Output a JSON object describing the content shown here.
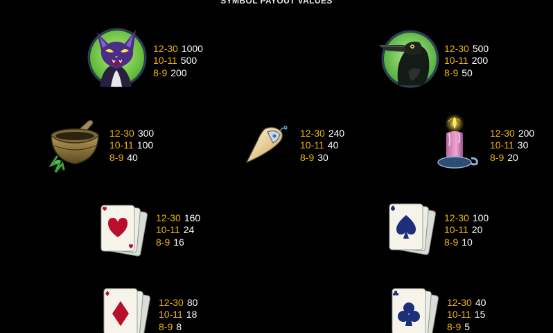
{
  "header": {
    "title": "SYMBOL PAYOUT VALUES"
  },
  "colors": {
    "background": "#000000",
    "range_text": "#f2b705",
    "value_text": "#ffffff"
  },
  "symbols": [
    {
      "icon": "black-cat-icon",
      "payouts": [
        {
          "range": "12-30",
          "value": "1000"
        },
        {
          "range": "10-11",
          "value": "500"
        },
        {
          "range": "8-9",
          "value": "200"
        }
      ]
    },
    {
      "icon": "raven-icon",
      "payouts": [
        {
          "range": "12-30",
          "value": "500"
        },
        {
          "range": "10-11",
          "value": "200"
        },
        {
          "range": "8-9",
          "value": "50"
        }
      ]
    },
    {
      "icon": "mortar-pestle-icon",
      "payouts": [
        {
          "range": "12-30",
          "value": "300"
        },
        {
          "range": "10-11",
          "value": "100"
        },
        {
          "range": "8-9",
          "value": "40"
        }
      ]
    },
    {
      "icon": "fang-amulet-icon",
      "payouts": [
        {
          "range": "12-30",
          "value": "240"
        },
        {
          "range": "10-11",
          "value": "40"
        },
        {
          "range": "8-9",
          "value": "30"
        }
      ]
    },
    {
      "icon": "candle-icon",
      "payouts": [
        {
          "range": "12-30",
          "value": "200"
        },
        {
          "range": "10-11",
          "value": "30"
        },
        {
          "range": "8-9",
          "value": "20"
        }
      ]
    },
    {
      "icon": "hearts-card-icon",
      "payouts": [
        {
          "range": "12-30",
          "value": "160"
        },
        {
          "range": "10-11",
          "value": "24"
        },
        {
          "range": "8-9",
          "value": "16"
        }
      ]
    },
    {
      "icon": "spades-card-icon",
      "payouts": [
        {
          "range": "12-30",
          "value": "100"
        },
        {
          "range": "10-11",
          "value": "20"
        },
        {
          "range": "8-9",
          "value": "10"
        }
      ]
    },
    {
      "icon": "diamonds-card-icon",
      "payouts": [
        {
          "range": "12-30",
          "value": "80"
        },
        {
          "range": "10-11",
          "value": "18"
        },
        {
          "range": "8-9",
          "value": "8"
        }
      ]
    },
    {
      "icon": "clubs-card-icon",
      "payouts": [
        {
          "range": "12-30",
          "value": "40"
        },
        {
          "range": "10-11",
          "value": "15"
        },
        {
          "range": "8-9",
          "value": "5"
        }
      ]
    }
  ]
}
